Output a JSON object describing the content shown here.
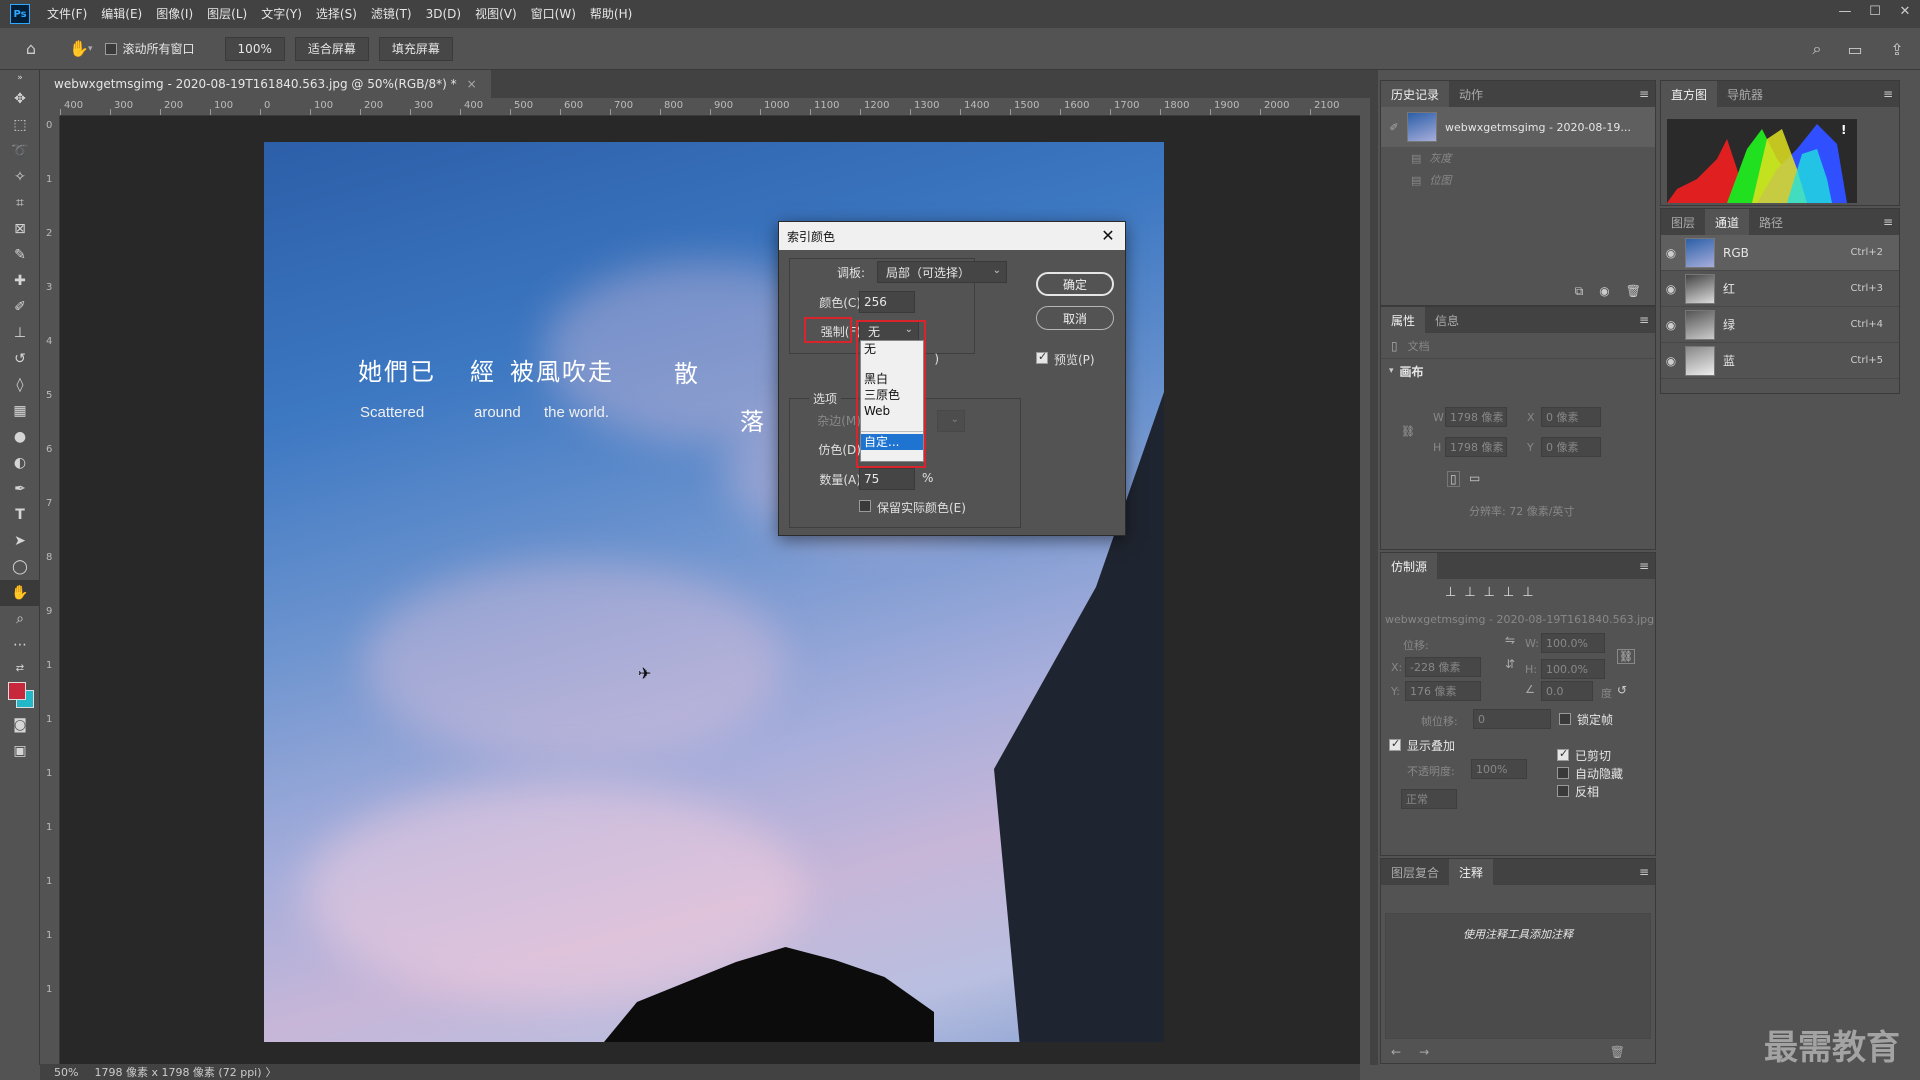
{
  "app": {
    "logo": "Ps"
  },
  "menu": [
    "文件(F)",
    "编辑(E)",
    "图像(I)",
    "图层(L)",
    "文字(Y)",
    "选择(S)",
    "滤镜(T)",
    "3D(D)",
    "视图(V)",
    "窗口(W)",
    "帮助(H)"
  ],
  "window_controls": {
    "minimize": "—",
    "maximize": "☐",
    "close": "✕"
  },
  "options_bar": {
    "scroll_all_label": "滚动所有窗口",
    "zoom_value": "100%",
    "fit_screen": "适合屏幕",
    "fill_screen": "填充屏幕"
  },
  "document": {
    "tab_title": "webwxgetmsgimg - 2020-08-19T161840.563.jpg @ 50%(RGB/8*) *",
    "tab_close": "×",
    "status_zoom": "50%",
    "status_info": "1798 像素 x 1798 像素 (72 ppi)",
    "status_caret": "〉"
  },
  "ruler": {
    "labels": [
      "400",
      "300",
      "200",
      "100",
      "0",
      "100",
      "200",
      "300",
      "400",
      "500",
      "600",
      "700",
      "800",
      "900",
      "1000",
      "1100",
      "1200",
      "1300",
      "1400",
      "1500",
      "1600",
      "1700",
      "1800",
      "1900",
      "2000",
      "2100"
    ],
    "left_labels": [
      "0",
      "1",
      "2",
      "3",
      "4",
      "5",
      "6",
      "7",
      "8",
      "9",
      "1",
      "1",
      "1",
      "1",
      "1",
      "1",
      "1"
    ]
  },
  "image_text": {
    "poem_1": "她們已",
    "poem_2": "經",
    "poem_3": "被風吹走",
    "poem_4": "散",
    "poem_5": "落",
    "en_1": "Scattered",
    "en_2": "around",
    "en_3": "the world.",
    "plane": "✈"
  },
  "dialog": {
    "title": "索引颜色",
    "close": "✕",
    "palette_label": "调板:",
    "palette_value": "局部（可选择）",
    "colors_label": "颜色(C):",
    "colors_value": "256",
    "forced_label": "强制(F):",
    "forced_value": "无",
    "options_header": "选项",
    "matte_label": "杂边(M):",
    "dither_label": "仿色(D):",
    "amount_label": "数量(A):",
    "amount_value": "75",
    "amount_unit": "%",
    "preserve_label": "保留实际颜色(E)",
    "ok": "确定",
    "cancel": "取消",
    "preview": "预览(P)",
    "preview_checked": true,
    "partial_text": ")",
    "dropdown_items": [
      "无",
      "黑白",
      "三原色",
      "Web",
      "自定..."
    ],
    "dropdown_selected": "自定..."
  },
  "history_panel": {
    "tabs": [
      "历史记录",
      "动作"
    ],
    "snapshot": "webwxgetmsgimg - 2020-08-19...",
    "items": [
      "灰度",
      "位图"
    ]
  },
  "histogram_panel": {
    "tabs": [
      "直方图",
      "导航器"
    ],
    "warning": "!"
  },
  "channels_panel": {
    "tabs": [
      "图层",
      "通道",
      "路径"
    ],
    "channels": [
      {
        "name": "RGB",
        "key": "Ctrl+2"
      },
      {
        "name": "红",
        "key": "Ctrl+3"
      },
      {
        "name": "绿",
        "key": "Ctrl+4"
      },
      {
        "name": "蓝",
        "key": "Ctrl+5"
      }
    ]
  },
  "properties_panel": {
    "tabs": [
      "属性",
      "信息"
    ],
    "doc_label": "文档",
    "canvas_header": "画布",
    "w_label": "W",
    "w_value": "1798 像素",
    "h_label": "H",
    "h_value": "1798 像素",
    "x_label": "X",
    "x_value": "0 像素",
    "y_label": "Y",
    "y_value": "0 像素",
    "resolution": "分辨率: 72 像素/英寸"
  },
  "clone_panel": {
    "tab": "仿制源",
    "filename": "webwxgetmsgimg - 2020-08-19T161840.563.jpg",
    "offset_label": "位移:",
    "x_label": "X:",
    "x_value": "-228 像素",
    "y_label": "Y:",
    "y_value": "176 像素",
    "w_label": "W:",
    "w_value": "100.0%",
    "h_label": "H:",
    "h_value": "100.0%",
    "angle_value": "0.0",
    "angle_unit": "度",
    "frame_offset_label": "帧位移:",
    "frame_offset_value": "0",
    "lock_frame": "锁定帧",
    "show_overlay": "显示叠加",
    "opacity_label": "不透明度:",
    "opacity_value": "100%",
    "clipped": "已剪切",
    "auto_hide": "自动隐藏",
    "invert": "反相",
    "mode": "正常"
  },
  "notes_panel": {
    "tabs": [
      "图层复合",
      "注释"
    ],
    "hint": "使用注释工具添加注释"
  },
  "watermark": "最需教育",
  "colors": {
    "foreground": "#c8283c",
    "background": "#23b8c8",
    "highlight": "#d9242c",
    "selection": "#1e74d0"
  }
}
